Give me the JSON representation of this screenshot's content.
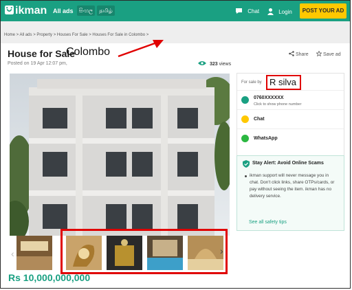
{
  "topbar": {
    "logo_text": "ikman",
    "all_ads": "All ads",
    "lang_sinhala": "සිංහල",
    "lang_tamil": "தமிழ்",
    "chat": "Chat",
    "login": "Login",
    "post_ad": "POST YOUR AD",
    "colors": {
      "brand": "#1aa082",
      "post": "#ffc800"
    }
  },
  "breadcrumb": "Home > All ads > Property > Houses For Sale > Houses For Sale in Colombo >",
  "listing": {
    "title": "House for Sale",
    "title_annotation": "Colombo",
    "posted": "Posted on 19 Apr 12:07 pm,",
    "views_count": "323",
    "views_label": "views",
    "share": "Share",
    "save": "Save ad",
    "price": "Rs 10,000,000,000"
  },
  "seller": {
    "label": "For sale by",
    "name": "R silva",
    "phone": "0760XXXXXX",
    "phone_hint": "Click to show phone number",
    "chat": "Chat",
    "whatsapp": "WhatsApp"
  },
  "safety": {
    "title": "Stay Alert: Avoid Online Scams",
    "body": "ikman support will never message you in chat. Don't click links, share OTPs/cards, or pay without seeing the item. ikman has no delivery service.",
    "link": "See all safety tips"
  }
}
